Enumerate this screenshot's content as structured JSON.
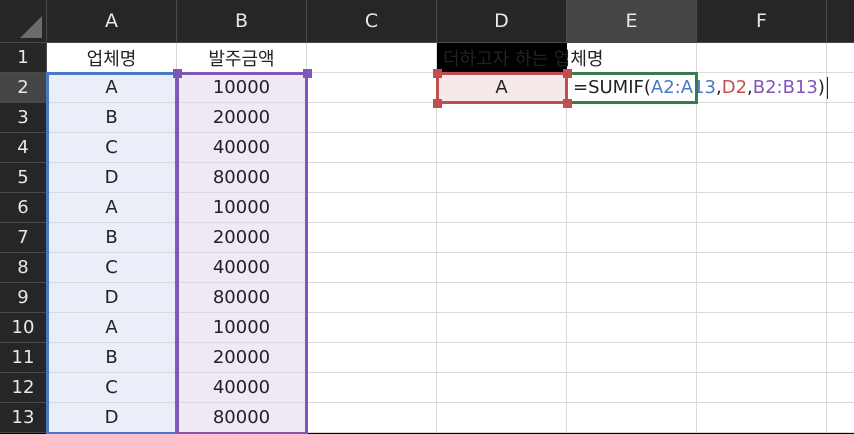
{
  "columns": [
    "A",
    "B",
    "C",
    "D",
    "E",
    "F"
  ],
  "active_column": "E",
  "active_row": "2",
  "rows": [
    {
      "num": "1",
      "a": "업체명",
      "b": "발주금액"
    },
    {
      "num": "2",
      "a": "A",
      "b": "10000"
    },
    {
      "num": "3",
      "a": "B",
      "b": "20000"
    },
    {
      "num": "4",
      "a": "C",
      "b": "40000"
    },
    {
      "num": "5",
      "a": "D",
      "b": "80000"
    },
    {
      "num": "6",
      "a": "A",
      "b": "10000"
    },
    {
      "num": "7",
      "a": "B",
      "b": "20000"
    },
    {
      "num": "8",
      "a": "C",
      "b": "40000"
    },
    {
      "num": "9",
      "a": "D",
      "b": "80000"
    },
    {
      "num": "10",
      "a": "A",
      "b": "10000"
    },
    {
      "num": "11",
      "a": "B",
      "b": "20000"
    },
    {
      "num": "12",
      "a": "C",
      "b": "40000"
    },
    {
      "num": "13",
      "a": "D",
      "b": "80000"
    }
  ],
  "d1_label": "더하고자 하는 업체명",
  "d2_value": "A",
  "formula": {
    "prefix": "=SUMIF(",
    "range": "A2:A13",
    "sep1": ",",
    "criteria": "D2",
    "sep2": ",",
    "sum_range": "B2:B13",
    "suffix": ")"
  },
  "colors": {
    "range_a": "#4a78c4",
    "range_b": "#7e57b8",
    "criteria_d": "#c0504d",
    "active_cell": "#3a7a50"
  }
}
